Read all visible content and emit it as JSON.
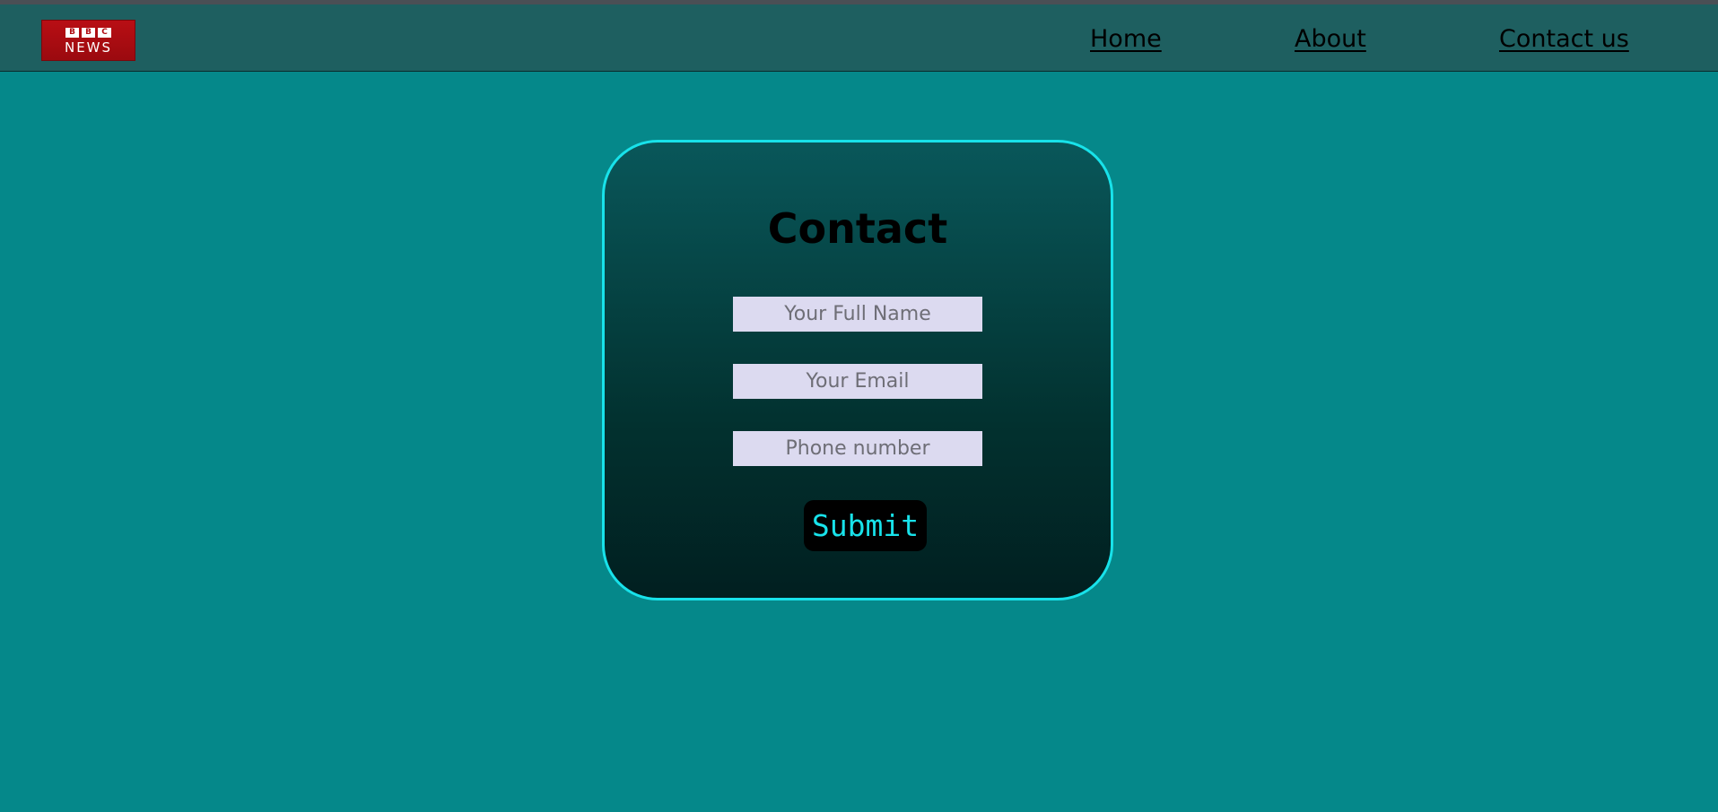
{
  "brand": {
    "logo_top": "BBC",
    "logo_top_letters": [
      "B",
      "B",
      "C"
    ],
    "logo_bottom": "NEWS",
    "logo_color": "#b80e14"
  },
  "nav": {
    "items": [
      {
        "label": "Home"
      },
      {
        "label": "About"
      },
      {
        "label": "Contact us"
      }
    ]
  },
  "contact_form": {
    "title": "Contact",
    "fields": [
      {
        "placeholder": "Your Full Name",
        "value": ""
      },
      {
        "placeholder": "Your Email",
        "value": ""
      },
      {
        "placeholder": "Phone number",
        "value": ""
      }
    ],
    "submit_label": "Submit"
  },
  "colors": {
    "page_background": "#05888a",
    "navbar_background": "#1e5f60",
    "card_border": "#18e2ea",
    "submit_text": "#18e2ea",
    "input_background": "#dcdaf0"
  }
}
